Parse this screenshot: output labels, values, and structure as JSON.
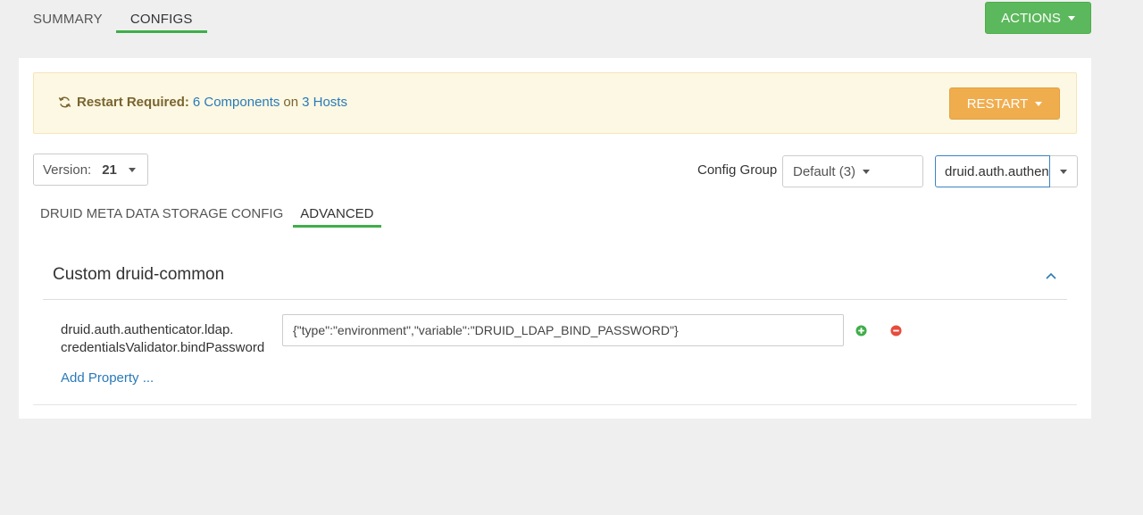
{
  "top_tabs": [
    {
      "label": "SUMMARY",
      "active": false
    },
    {
      "label": "CONFIGS",
      "active": true
    }
  ],
  "actions_label": "ACTIONS",
  "alert": {
    "label": "Restart Required:",
    "components_link": "6 Components",
    "connector": "on",
    "hosts_link": "3 Hosts",
    "restart_label": "RESTART"
  },
  "version": {
    "label": "Version:",
    "value": "21"
  },
  "config_group": {
    "label": "Config Group",
    "selected": "Default (3)"
  },
  "filter": {
    "value": "druid.auth.authenticator.ldap.credentialsValidator.bindPassword"
  },
  "sub_tabs": [
    {
      "label": "DRUID META DATA STORAGE CONFIG",
      "active": false
    },
    {
      "label": "ADVANCED",
      "active": true
    }
  ],
  "section": {
    "title": "Custom druid-common",
    "property": {
      "name_line1": "druid.auth.authenticator.ldap.",
      "name_line2": "credentialsValidator.bindPassword",
      "value": "{\"type\":\"environment\",\"variable\":\"DRUID_LDAP_BIND_PASSWORD\"}"
    },
    "add_property_label": "Add Property ..."
  },
  "colors": {
    "accent_green": "#3fae49",
    "actions_green": "#5cb85c",
    "restart_orange": "#f0ad4e",
    "link_blue": "#2a7ab8",
    "alert_bg": "#fcf8e3",
    "remove_red": "#e74c3c"
  },
  "icons": [
    "refresh-icon",
    "caret-down-icon",
    "chevron-up-icon",
    "plus-circle-icon",
    "minus-circle-icon"
  ]
}
